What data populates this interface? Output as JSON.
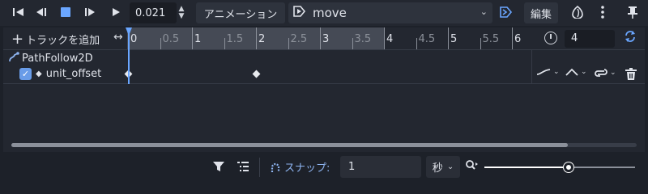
{
  "toolbar": {
    "speed_value": "0.021",
    "animation_label": "アニメーション",
    "animation_name": "move",
    "edit_label": "編集"
  },
  "timeline": {
    "add_track_label": "トラックを追加",
    "ticks": [
      {
        "label": "0",
        "major": true
      },
      {
        "label": "0.5",
        "major": false
      },
      {
        "label": "1",
        "major": true
      },
      {
        "label": "1.5",
        "major": false
      },
      {
        "label": "2",
        "major": true
      },
      {
        "label": "2.5",
        "major": false
      },
      {
        "label": "3",
        "major": true
      },
      {
        "label": "3.5",
        "major": false
      },
      {
        "label": "4",
        "major": true
      },
      {
        "label": "4.5",
        "major": false
      },
      {
        "label": "5",
        "major": true
      },
      {
        "label": "5.5",
        "major": false
      },
      {
        "label": "6",
        "major": true
      }
    ],
    "length_value": "4",
    "playhead_time": 0,
    "scroll_fraction": 0.89
  },
  "tracks": {
    "node_name": "PathFollow2D",
    "track_name": "unit_offset",
    "enabled": true,
    "keyframe_times": [
      0,
      2
    ]
  },
  "bottom": {
    "snap_label": "スナップ:",
    "snap_value": "1",
    "snap_unit": "秒",
    "zoom_level": 0.56
  },
  "icons": {
    "play_back_start": "skip-back-icon",
    "play_back": "play-backward-icon",
    "stop": "stop-icon",
    "play_from_start": "play-from-start-icon",
    "play": "play-icon",
    "autoplay": "autoplay-icon",
    "onion": "onion-skin-icon",
    "menu": "kebab-menu-icon",
    "pin": "pin-icon"
  },
  "colors": {
    "accent": "#6aa6ff",
    "background": "#1d2129",
    "panel": "#232730"
  }
}
